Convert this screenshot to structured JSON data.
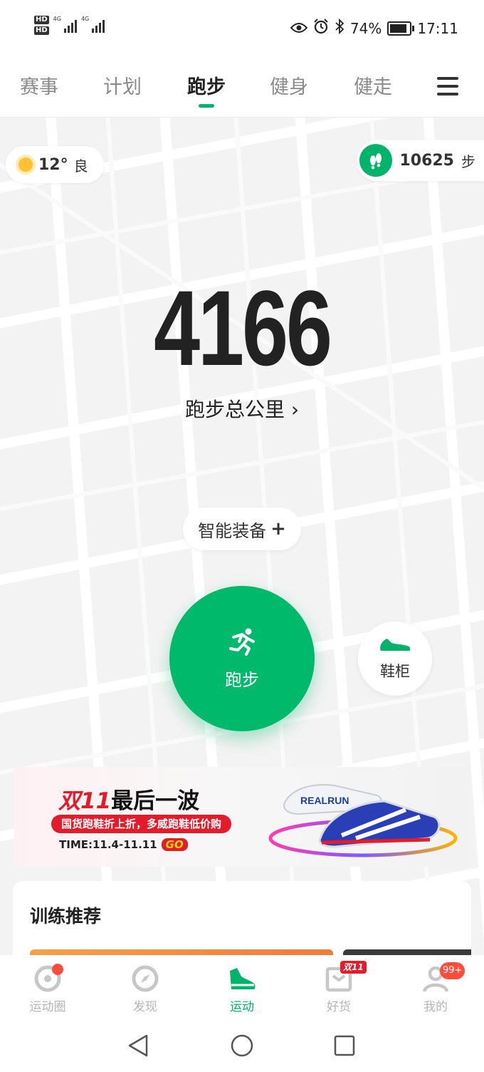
{
  "status_bar": {
    "sim1_label": "HD",
    "sim2_label": "HD",
    "network1": "4G",
    "network2": "4G",
    "battery": "74%",
    "time": "17:11"
  },
  "top_tabs": [
    {
      "label": "赛事"
    },
    {
      "label": "计划"
    },
    {
      "label": "跑步"
    },
    {
      "label": "健身"
    },
    {
      "label": "健走"
    }
  ],
  "weather": {
    "temperature": "12°",
    "air_quality": "良"
  },
  "steps": {
    "count": "10625",
    "unit": "步"
  },
  "total": {
    "value": "4166",
    "label": "跑步总公里 ›"
  },
  "device_button": {
    "label": "智能装备",
    "plus": "+"
  },
  "run_button": {
    "label": "跑步"
  },
  "shoe_button": {
    "label": "鞋柜"
  },
  "banner": {
    "title_highlight": "双11",
    "title_rest": "最后一波",
    "subtitle": "国货跑鞋折上折，多威跑鞋低价购",
    "time": "TIME:11.4-11.11",
    "go": "GO",
    "shoe_text": "REALRUN"
  },
  "training": {
    "title": "训练推荐"
  },
  "bottom_nav": [
    {
      "label": "运动圈"
    },
    {
      "label": "发现"
    },
    {
      "label": "运动"
    },
    {
      "label": "好货",
      "tag": "双11"
    },
    {
      "label": "我的",
      "badge": "99+"
    }
  ],
  "colors": {
    "brand_green": "#00b36b",
    "promo_red": "#e21c2a"
  }
}
